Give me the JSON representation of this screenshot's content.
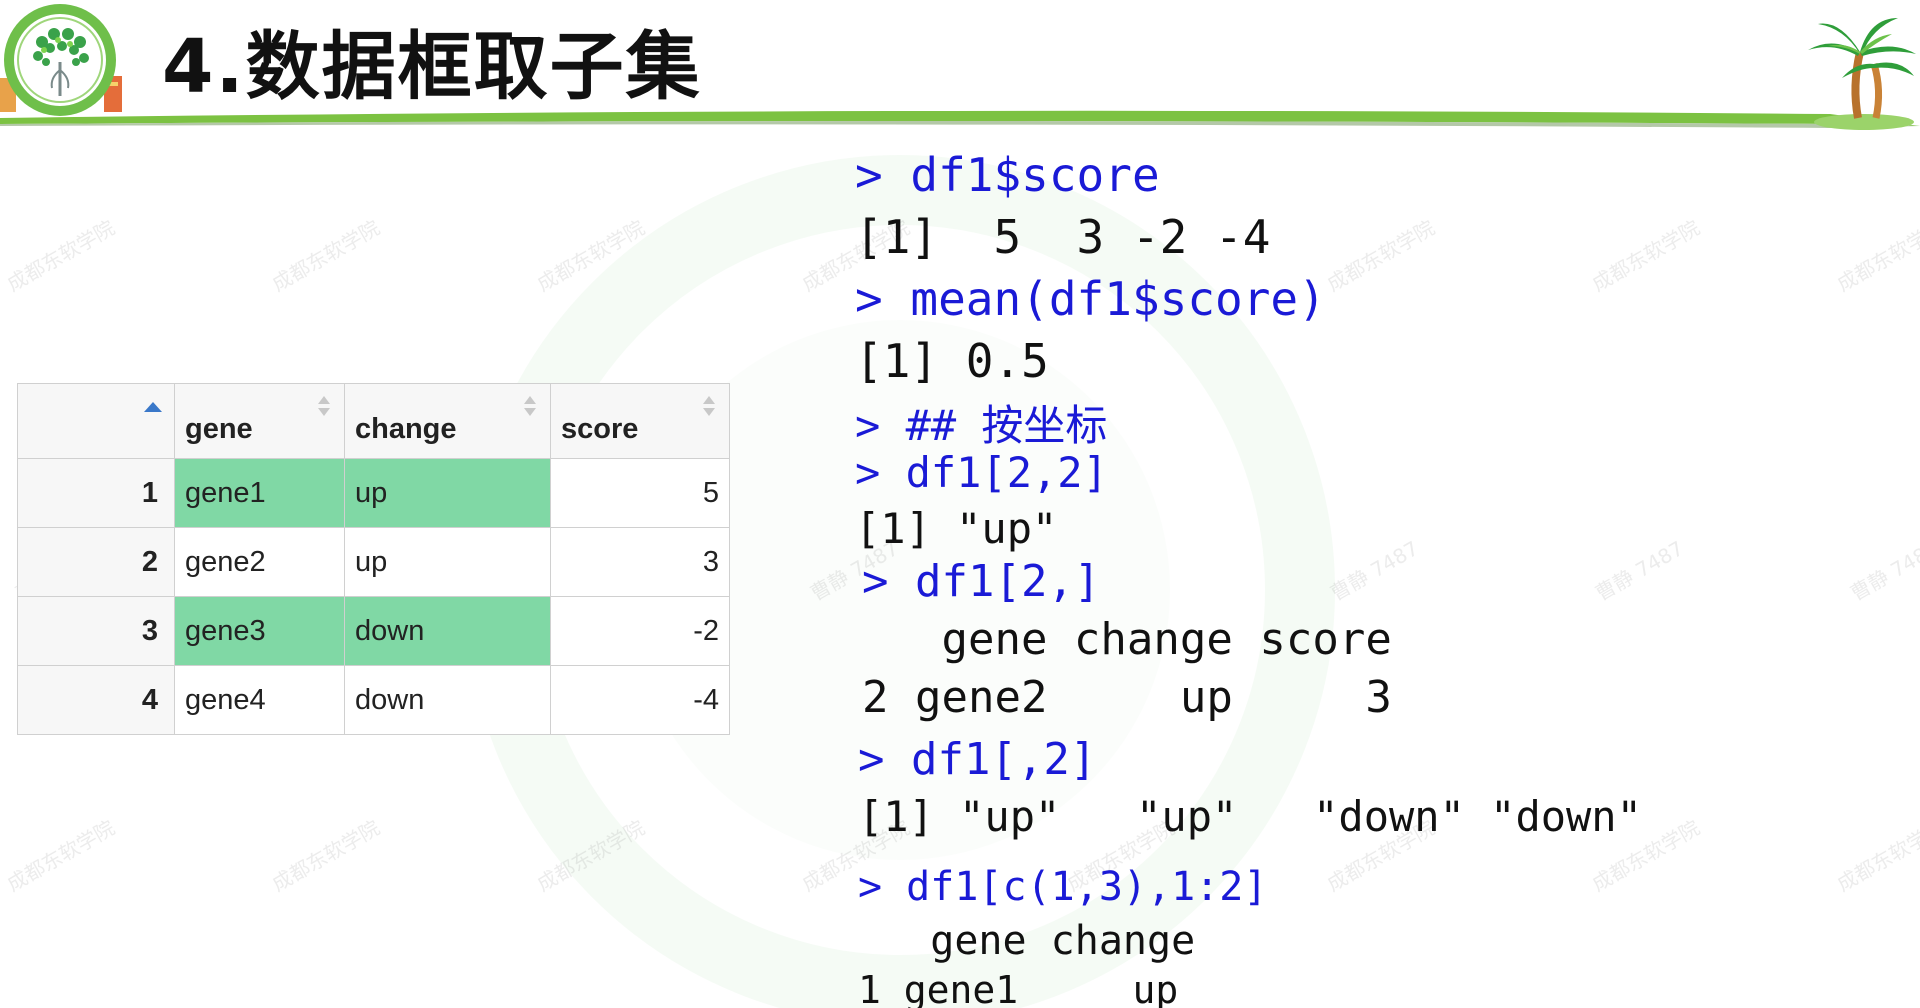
{
  "header": {
    "title": "4.数据框取子集"
  },
  "table": {
    "columns": [
      "gene",
      "change",
      "score"
    ],
    "rows": [
      {
        "n": "1",
        "gene": "gene1",
        "change": "up",
        "score": "5"
      },
      {
        "n": "2",
        "gene": "gene2",
        "change": "up",
        "score": "3"
      },
      {
        "n": "3",
        "gene": "gene3",
        "change": "down",
        "score": "-2"
      },
      {
        "n": "4",
        "gene": "gene4",
        "change": "down",
        "score": "-4"
      }
    ]
  },
  "console": {
    "lines": [
      "> df1$score",
      "[1]  5  3 -2 -4",
      "> mean(df1$score)",
      "[1] 0.5",
      "> ## 按坐标",
      "> df1[2,2]",
      "[1] \"up\"",
      "> df1[2,]",
      "   gene change score",
      "2 gene2     up     3",
      "> df1[,2]",
      "[1] \"up\"   \"up\"   \"down\" \"down\"",
      "> df1[c(1,3),1:2]",
      "   gene change",
      "1 gene1     up"
    ]
  },
  "watermark": {
    "brand": "成都东软学院",
    "user": "曹静 7487"
  },
  "colors": {
    "highlight": "#80d8a5",
    "command": "#1a1ad6",
    "header_line": "#7cc242"
  }
}
